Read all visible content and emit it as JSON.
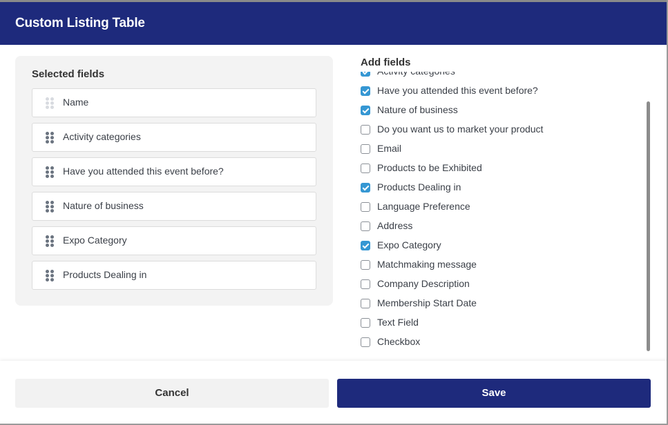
{
  "header": {
    "title": "Custom Listing Table"
  },
  "selected": {
    "title": "Selected fields",
    "items": [
      {
        "label": "Name",
        "locked": true
      },
      {
        "label": "Activity categories",
        "locked": false
      },
      {
        "label": "Have you attended this event before?",
        "locked": false
      },
      {
        "label": "Nature of business",
        "locked": false
      },
      {
        "label": "Expo Category",
        "locked": false
      },
      {
        "label": "Products Dealing in",
        "locked": false
      }
    ]
  },
  "add": {
    "title": "Add fields",
    "items": [
      {
        "label": "Activity categories",
        "checked": true
      },
      {
        "label": "Have you attended this event before?",
        "checked": true
      },
      {
        "label": "Nature of business",
        "checked": true
      },
      {
        "label": "Do you want us to market your product",
        "checked": false
      },
      {
        "label": "Email",
        "checked": false
      },
      {
        "label": "Products to be Exhibited",
        "checked": false
      },
      {
        "label": "Products Dealing in",
        "checked": true
      },
      {
        "label": "Language Preference",
        "checked": false
      },
      {
        "label": "Address",
        "checked": false
      },
      {
        "label": "Expo Category",
        "checked": true
      },
      {
        "label": "Matchmaking message",
        "checked": false
      },
      {
        "label": "Company Description",
        "checked": false
      },
      {
        "label": "Membership Start Date",
        "checked": false
      },
      {
        "label": "Text Field",
        "checked": false
      },
      {
        "label": "Checkbox",
        "checked": false
      }
    ]
  },
  "footer": {
    "cancel_label": "Cancel",
    "save_label": "Save"
  },
  "colors": {
    "brand": "#1e2a7c",
    "checkbox_checked": "#3597d3",
    "panel_bg": "#f3f3f3"
  }
}
